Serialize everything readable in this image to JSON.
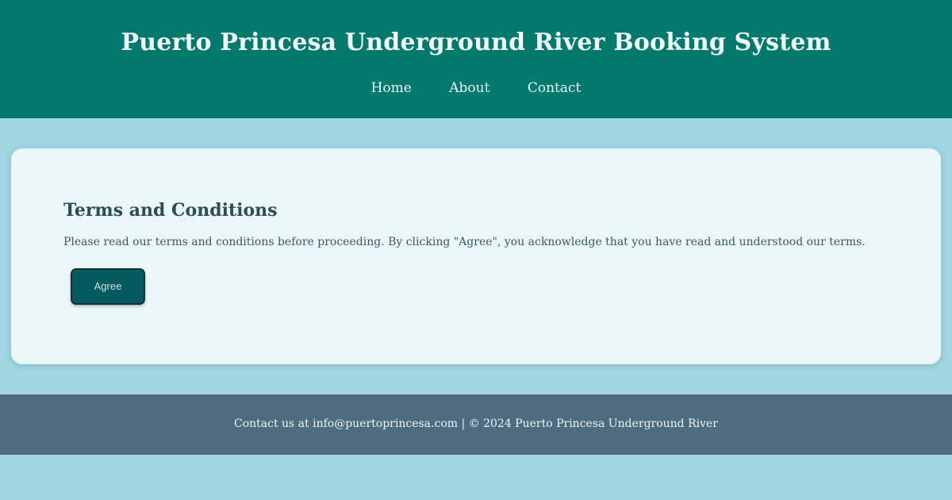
{
  "header": {
    "title": "Puerto Princesa Underground River Booking System",
    "nav": [
      {
        "label": "Home"
      },
      {
        "label": "About"
      },
      {
        "label": "Contact"
      }
    ]
  },
  "main": {
    "heading": "Terms and Conditions",
    "description": "Please read our terms and conditions before proceeding. By clicking \"Agree\", you acknowledge that you have read and understood our terms.",
    "agree_button": "Agree"
  },
  "footer": {
    "prefix": "Contact us at ",
    "email": "info@puertoprincesa.com",
    "suffix": " | © 2024 Puerto Princesa Underground River"
  },
  "colors": {
    "header_bg": "#01796c",
    "page_bg": "#a1d5e2",
    "card_bg": "#eaf6f8",
    "button_bg": "#055a60",
    "footer_bg": "#4d6c80"
  }
}
